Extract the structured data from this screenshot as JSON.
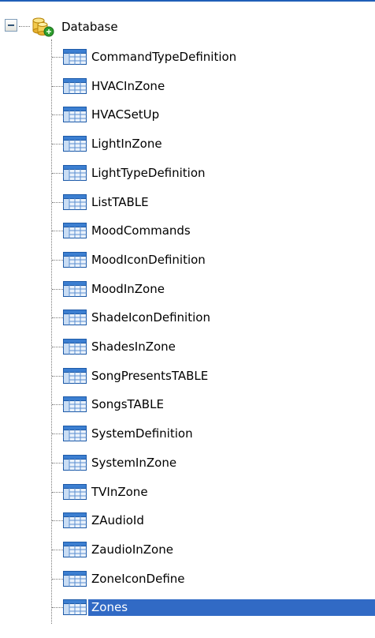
{
  "tree": {
    "root": {
      "label": "Database",
      "icon": "database-icon",
      "expanded": true
    },
    "items": [
      {
        "label": "CommandTypeDefinition",
        "icon": "table-icon"
      },
      {
        "label": "HVACInZone",
        "icon": "table-icon"
      },
      {
        "label": "HVACSetUp",
        "icon": "table-icon"
      },
      {
        "label": "LightInZone",
        "icon": "table-icon"
      },
      {
        "label": "LightTypeDefinition",
        "icon": "table-icon"
      },
      {
        "label": "ListTABLE",
        "icon": "table-icon"
      },
      {
        "label": "MoodCommands",
        "icon": "table-icon"
      },
      {
        "label": "MoodIconDefinition",
        "icon": "table-icon"
      },
      {
        "label": "MoodInZone",
        "icon": "table-icon"
      },
      {
        "label": "ShadeIconDefinition",
        "icon": "table-icon"
      },
      {
        "label": "ShadesInZone",
        "icon": "table-icon"
      },
      {
        "label": "SongPresentsTABLE",
        "icon": "table-icon"
      },
      {
        "label": "SongsTABLE",
        "icon": "table-icon"
      },
      {
        "label": "SystemDefinition",
        "icon": "table-icon"
      },
      {
        "label": "SystemInZone",
        "icon": "table-icon"
      },
      {
        "label": "TVInZone",
        "icon": "table-icon"
      },
      {
        "label": "ZAudioId",
        "icon": "table-icon"
      },
      {
        "label": "ZaudioInZone",
        "icon": "table-icon"
      },
      {
        "label": "ZoneIconDefine",
        "icon": "table-icon"
      },
      {
        "label": "Zones",
        "icon": "table-icon",
        "selected": true
      }
    ]
  },
  "colors": {
    "selection": "#316ac5",
    "top_border": "#1f5fb8",
    "connector": "#7a7a7a"
  }
}
